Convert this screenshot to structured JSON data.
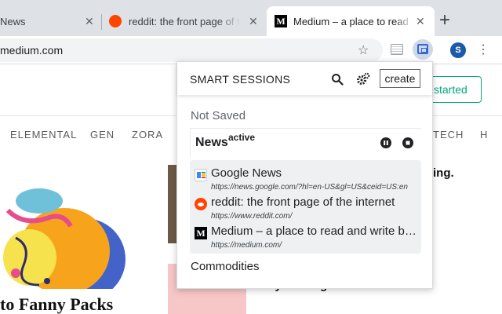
{
  "browser": {
    "tabs": [
      {
        "title": "News",
        "favicon": "news-favicon"
      },
      {
        "title": "reddit: the front page of the internet",
        "favicon": "reddit-favicon"
      },
      {
        "title": "Medium – a place to read and write big ideas",
        "favicon": "medium-favicon",
        "active": true
      }
    ],
    "new_tab_symbol": "+",
    "close_symbol": "✕",
    "address": "medium.com",
    "profile_initial": "S",
    "colors": {
      "accent": "#3367d6",
      "profile": "#1a5aa8"
    }
  },
  "page": {
    "cta_label": "started",
    "topics": [
      "ELEMENTAL",
      "GEN",
      "ZORA",
      "TECH",
      "H"
    ],
    "hero_title": "to Fanny Packs",
    "article_fragment": "ing.",
    "article2_title": "My Marriage",
    "colors": {
      "accent": "#03a87c"
    }
  },
  "extension": {
    "title": "SMART SESSIONS",
    "create_label": "create",
    "unsaved_label": "Not Saved",
    "session": {
      "name": "News",
      "status": "active",
      "tabs": [
        {
          "title": "Google News",
          "url": "https://news.google.com/?hl=en-US&gl=US&ceid=US:en",
          "icon": "google-news-favicon"
        },
        {
          "title": "reddit: the front page of the internet",
          "url": "https://www.reddit.com/",
          "icon": "reddit-favicon"
        },
        {
          "title": "Medium – a place to read and write big ideas",
          "url": "https://medium.com/",
          "icon": "medium-favicon"
        }
      ]
    },
    "other_sessions": [
      "Commodities"
    ]
  }
}
